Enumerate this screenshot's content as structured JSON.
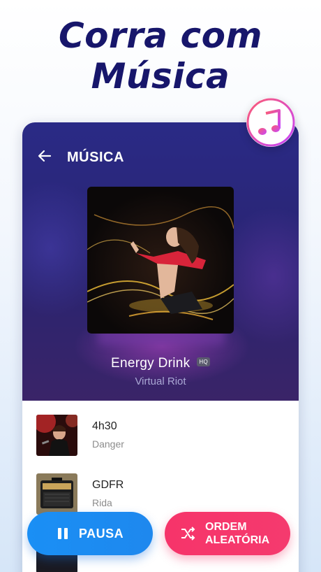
{
  "headline": {
    "line1": "Corra com",
    "line2": "Música"
  },
  "screen": {
    "title": "MÚSICA",
    "now_playing": {
      "title": "Energy Drink",
      "badge": "HQ",
      "artist": "Virtual Riot"
    },
    "songs": [
      {
        "title": "4h30",
        "artist": "Danger",
        "thumb": "concert-singer-thumb"
      },
      {
        "title": "GDFR",
        "artist": "Rida",
        "thumb": "amplifier-thumb"
      }
    ]
  },
  "controls": {
    "pause_label": "PAUSA",
    "shuffle_line1": "ORDEM",
    "shuffle_line2": "ALEATÓRIA"
  },
  "colors": {
    "headline": "#17166b",
    "hero_bg": "#2a2a86",
    "pause_button": "#1a8ff5",
    "shuffle_button": "#f6346a"
  }
}
